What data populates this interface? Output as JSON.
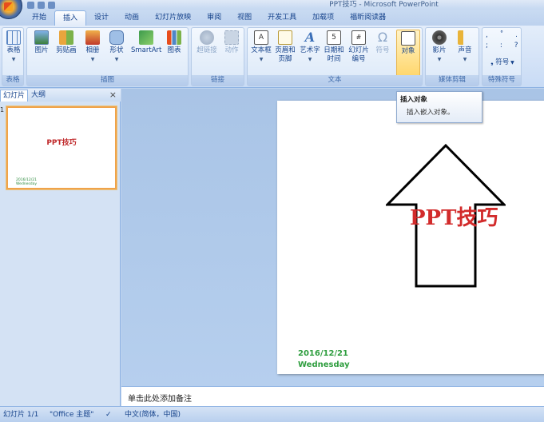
{
  "window": {
    "title": "PPT技巧 - Microsoft PowerPoint"
  },
  "tabs": [
    "开始",
    "插入",
    "设计",
    "动画",
    "幻灯片放映",
    "审阅",
    "视图",
    "开发工具",
    "加载项",
    "福昕阅读器"
  ],
  "active_tab": "插入",
  "ribbon": {
    "groups": {
      "table": {
        "label": "表格",
        "buttons": [
          "表格"
        ]
      },
      "illustrations": {
        "label": "插图",
        "buttons": [
          "图片",
          "剪贴画",
          "相册",
          "形状",
          "SmartArt",
          "图表"
        ]
      },
      "links": {
        "label": "链接",
        "buttons": [
          "超链接",
          "动作"
        ]
      },
      "text": {
        "label": "文本",
        "buttons": [
          "文本框",
          "页眉和页脚",
          "艺术字",
          "日期和时间",
          "幻灯片编号",
          "符号",
          "对象"
        ]
      },
      "media": {
        "label": "媒体剪辑",
        "buttons": [
          "影片",
          "声音"
        ]
      },
      "special": {
        "label": "特殊符号",
        "buttons": [
          "符号"
        ]
      }
    }
  },
  "tooltip": {
    "title": "插入对象",
    "description": "插入嵌入对象。"
  },
  "pane": {
    "tabs": [
      "幻灯片",
      "大纲"
    ],
    "close": "×",
    "slide_number": "1"
  },
  "slide": {
    "title": "PPT技巧",
    "date": "2016/12/21",
    "weekday": "Wednesday"
  },
  "notes": {
    "placeholder": "单击此处添加备注"
  },
  "status": {
    "slide": "幻灯片 1/1",
    "theme": "\"Office 主题\"",
    "language": "中文(简体，中国)"
  },
  "colors": {
    "title_red": "#d22b2b",
    "date_green": "#2f9e3f",
    "ribbon_blue": "#15428b"
  }
}
